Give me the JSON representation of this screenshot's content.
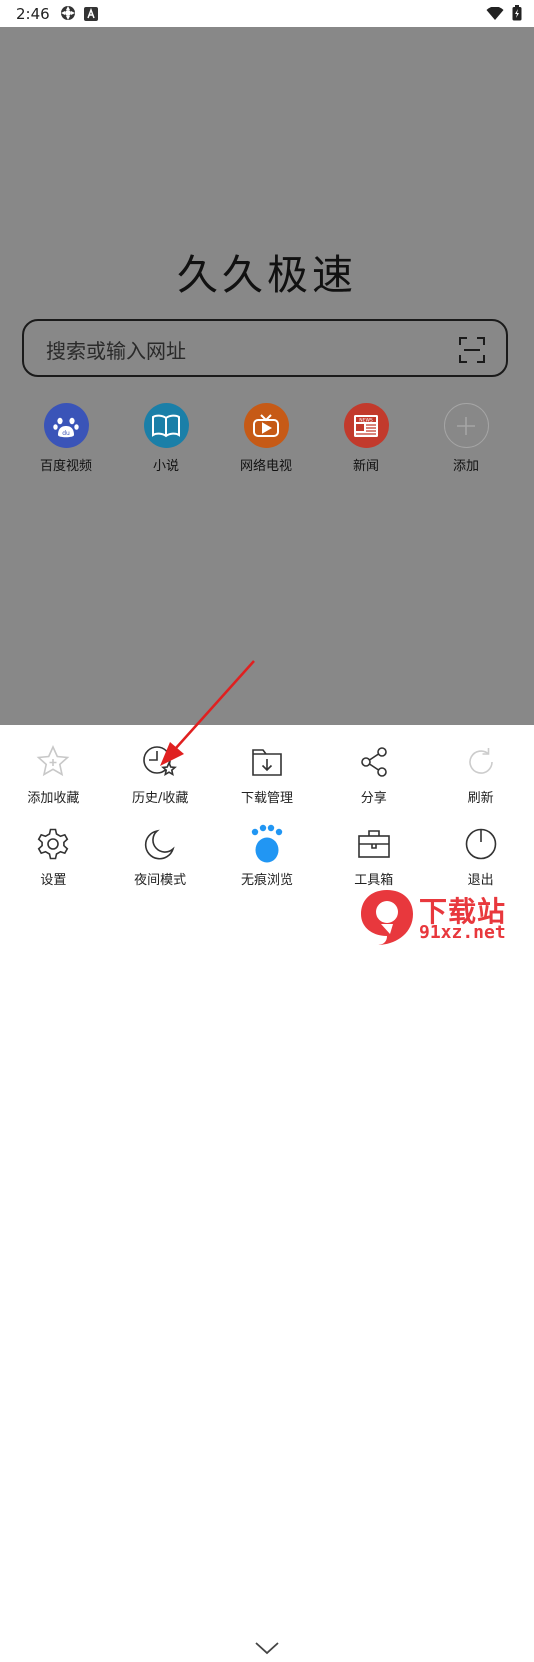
{
  "status_bar": {
    "time": "2:46"
  },
  "home": {
    "title": "久久极速",
    "search_placeholder": "搜索或输入网址",
    "shortcuts": [
      {
        "label": "百度视频",
        "icon": "baidu-paw-icon",
        "color": "#3a54b8"
      },
      {
        "label": "小说",
        "icon": "book-icon",
        "color": "#1a7fa8"
      },
      {
        "label": "网络电视",
        "icon": "tv-icon",
        "color": "#c65a16"
      },
      {
        "label": "新闻",
        "icon": "news-icon",
        "color": "#c23a2c"
      },
      {
        "label": "添加",
        "icon": "plus-icon",
        "color": "#888888"
      }
    ]
  },
  "menu": {
    "row1": [
      {
        "label": "添加收藏",
        "icon": "star-plus-icon"
      },
      {
        "label": "历史/收藏",
        "icon": "clock-star-icon"
      },
      {
        "label": "下载管理",
        "icon": "download-folder-icon"
      },
      {
        "label": "分享",
        "icon": "share-icon"
      },
      {
        "label": "刷新",
        "icon": "refresh-icon"
      }
    ],
    "row2": [
      {
        "label": "设置",
        "icon": "gear-icon"
      },
      {
        "label": "夜间模式",
        "icon": "moon-icon"
      },
      {
        "label": "无痕浏览",
        "icon": "incognito-paw-icon",
        "color": "#2196f3"
      },
      {
        "label": "工具箱",
        "icon": "toolbox-icon"
      },
      {
        "label": "退出",
        "icon": "power-icon"
      }
    ]
  },
  "watermark": {
    "text": "下载站",
    "url": "91xz.net"
  },
  "colors": {
    "dim_overlay": "#888888",
    "arrow": "#e02020",
    "accent_blue": "#2196f3",
    "watermark_red": "#e8383d"
  }
}
